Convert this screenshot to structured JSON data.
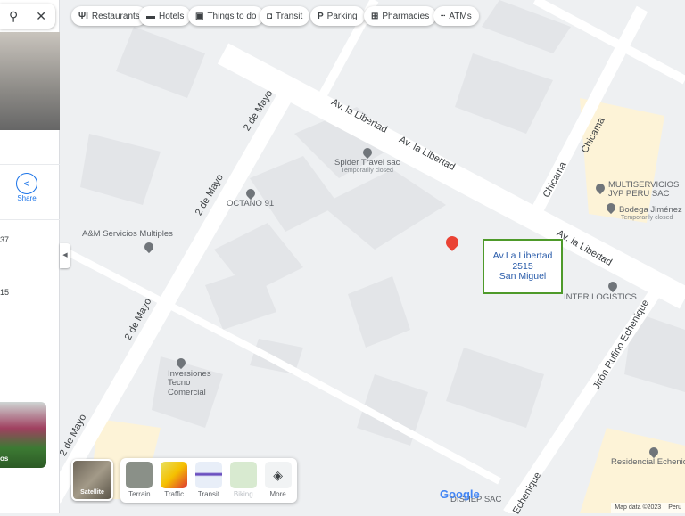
{
  "search_panel": {
    "search_icon": "search-icon",
    "close_icon": "close-icon",
    "share_label": "Share",
    "detail_line_1": "37",
    "detail_line_2": "15",
    "photo_caption": "os"
  },
  "chips": [
    {
      "icon": "restaurant-icon",
      "glyph": "ΨΙ",
      "label": "Restaurants"
    },
    {
      "icon": "hotel-icon",
      "glyph": "▬",
      "label": "Hotels"
    },
    {
      "icon": "camera-icon",
      "glyph": "▣",
      "label": "Things to do"
    },
    {
      "icon": "transit-icon",
      "glyph": "◘",
      "label": "Transit"
    },
    {
      "icon": "parking-icon",
      "glyph": "P",
      "label": "Parking"
    },
    {
      "icon": "pharmacy-icon",
      "glyph": "⊞",
      "label": "Pharmacies"
    },
    {
      "icon": "atm-icon",
      "glyph": "▪▪▪",
      "label": "ATMs"
    }
  ],
  "streets": {
    "libertad_1": "Av. la Libertad",
    "libertad_2": "Av. la Libertad",
    "libertad_3": "Av. la Libertad",
    "mayo_1": "2 de Mayo",
    "mayo_2": "2 de Mayo",
    "mayo_3": "2 de Mayo",
    "mayo_4": "2 de Mayo",
    "chicama_1": "Chicama",
    "chicama_2": "Chicama",
    "echenique_1": "Jirón Rufino Echenique",
    "echenique_2": "Echenique"
  },
  "pois": [
    {
      "name": "Spider Travel sac",
      "note": "Temporarily closed"
    },
    {
      "name": "OCTANO 91"
    },
    {
      "name": "A&M Servicios Multiples"
    },
    {
      "name": "MULTISERVICIOS JVP PERU SAC"
    },
    {
      "name": "Bodega Jiménez",
      "note": "Temporarily closed"
    },
    {
      "name": "INTER LOGISTICS"
    },
    {
      "name": "Inversiones Tecno Comercial"
    },
    {
      "name": "Residencial Echenique"
    },
    {
      "name": "DISHEP SAC"
    }
  ],
  "annotation": {
    "line1": "Av.La Libertad",
    "line2": "2515",
    "line3": "San Miguel"
  },
  "layers": {
    "satellite": "Satellite",
    "terrain": "Terrain",
    "traffic": "Traffic",
    "transit": "Transit",
    "biking": "Biking",
    "more": "More"
  },
  "footer": {
    "google": "Google",
    "map_data": "Map data ©2023",
    "region": "Peru"
  },
  "colors": {
    "pin": "#ea4335",
    "annotation_border": "#4e9a2a"
  }
}
